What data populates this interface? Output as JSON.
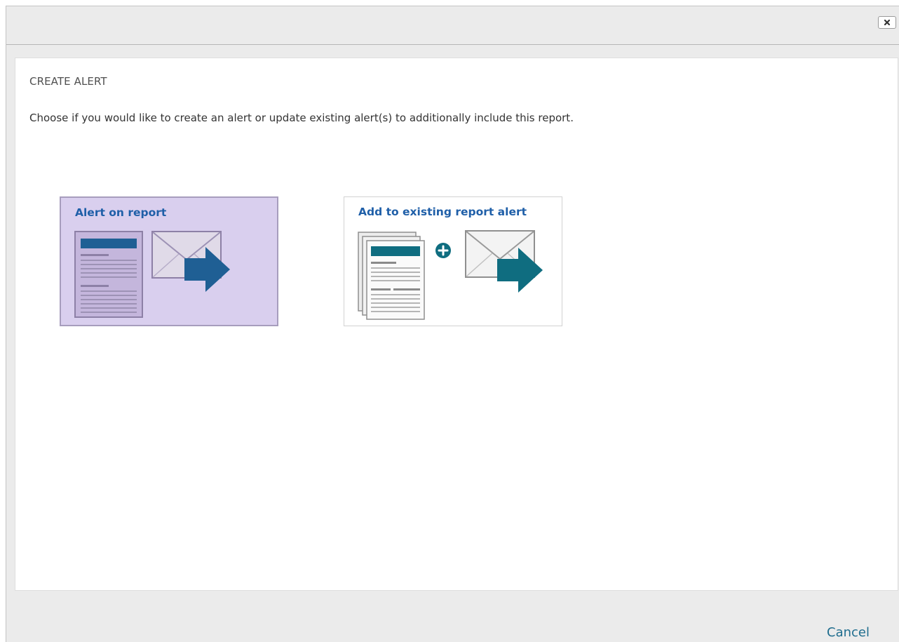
{
  "dialog": {
    "close_icon": "close-icon"
  },
  "content": {
    "heading": "CREATE ALERT",
    "description": "Choose if you would like to create an alert or update existing alert(s) to additionally include this report.",
    "options": [
      {
        "label": "Alert on report",
        "icon": "report-envelope-arrow-icon",
        "selected": true
      },
      {
        "label": "Add to existing report alert",
        "icon": "reports-plus-envelope-arrow-icon",
        "selected": false
      }
    ]
  },
  "footer": {
    "cancel_label": "Cancel"
  },
  "colors": {
    "selected_bg": "#d9cfee",
    "title_blue": "#1f5fa8",
    "arrow_blue": "#1f5fa8",
    "arrow_teal": "#0f6d80",
    "cancel_link": "#1f6d8e"
  }
}
